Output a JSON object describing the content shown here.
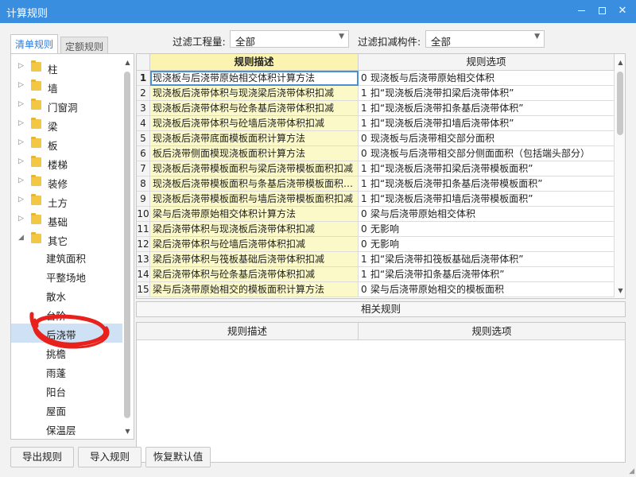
{
  "window": {
    "title": "计算规则"
  },
  "tabs": {
    "list_rules": "清单规则",
    "quota_rules": "定额规则"
  },
  "filters": {
    "quantity_label": "过滤工程量:",
    "quantity_value": "全部",
    "component_label": "过滤扣减构件:",
    "component_value": "全部"
  },
  "tree": {
    "folders": [
      "柱",
      "墙",
      "门窗洞",
      "梁",
      "板",
      "楼梯",
      "装修",
      "土方",
      "基础",
      "其它"
    ],
    "expanded_folder": "其它",
    "children": [
      "建筑面积",
      "平整场地",
      "散水",
      "台阶",
      "后浇带",
      "挑檐",
      "雨蓬",
      "阳台",
      "屋面",
      "保温层"
    ],
    "selected_child": "后浇带"
  },
  "rules_grid": {
    "header_desc": "规则描述",
    "header_opt": "规则选项",
    "rows": [
      {
        "num": "1",
        "desc": "现浇板与后浇带原始相交体积计算方法",
        "flag": "0",
        "option": "现浇板与后浇带原始相交体积"
      },
      {
        "num": "2",
        "desc": "现浇板后浇带体积与现浇梁后浇带体积扣减",
        "flag": "1",
        "option": "扣“现浇板后浇带扣梁后浇带体积”"
      },
      {
        "num": "3",
        "desc": "现浇板后浇带体积与砼条基后浇带体积扣减",
        "flag": "1",
        "option": "扣“现浇板后浇带扣条基后浇带体积”"
      },
      {
        "num": "4",
        "desc": "现浇板后浇带体积与砼墙后浇带体积扣减",
        "flag": "1",
        "option": "扣“现浇板后浇带扣墙后浇带体积”"
      },
      {
        "num": "5",
        "desc": "现浇板后浇带底面模板面积计算方法",
        "flag": "0",
        "option": "现浇板与后浇带相交部分面积"
      },
      {
        "num": "6",
        "desc": "板后浇带侧面模现浇板面积计算方法",
        "flag": "0",
        "option": "现浇板与后浇带相交部分侧面面积（包括端头部分）"
      },
      {
        "num": "7",
        "desc": "现浇板后浇带模板面积与梁后浇带模板面积扣减",
        "flag": "1",
        "option": "扣“现浇板后浇带扣梁后浇带模板面积”"
      },
      {
        "num": "8",
        "desc": "现浇板后浇带模板面积与条基后浇带模板面积扣减",
        "flag": "1",
        "option": "扣“现浇板后浇带扣条基后浇带模板面积”"
      },
      {
        "num": "9",
        "desc": "现浇板后浇带模板面积与墙后浇带模板面积扣减",
        "flag": "1",
        "option": "扣“现浇板后浇带扣墙后浇带模板面积”"
      },
      {
        "num": "10",
        "desc": "梁与后浇带原始相交体积计算方法",
        "flag": "0",
        "option": "梁与后浇带原始相交体积"
      },
      {
        "num": "11",
        "desc": "梁后浇带体积与现浇板后浇带体积扣减",
        "flag": "0",
        "option": "无影响"
      },
      {
        "num": "12",
        "desc": "梁后浇带体积与砼墙后浇带体积扣减",
        "flag": "0",
        "option": "无影响"
      },
      {
        "num": "13",
        "desc": "梁后浇带体积与筏板基础后浇带体积扣减",
        "flag": "1",
        "option": "扣“梁后浇带扣筏板基础后浇带体积”"
      },
      {
        "num": "14",
        "desc": "梁后浇带体积与砼条基后浇带体积扣减",
        "flag": "1",
        "option": "扣“梁后浇带扣条基后浇带体积”"
      },
      {
        "num": "15",
        "desc": "梁与后浇带原始相交的模板面积计算方法",
        "flag": "0",
        "option": "梁与后浇带原始相交的模板面积"
      }
    ]
  },
  "related": {
    "title": "相关规则",
    "header_desc": "规则描述",
    "header_opt": "规则选项"
  },
  "buttons": {
    "export": "导出规则",
    "import": "导入规则",
    "restore": "恢复默认值"
  },
  "colors": {
    "titlebar": "#3a8ee0",
    "highlight_column": "#fbf9c8",
    "annotation": "#e8211c"
  },
  "icons": {
    "folder": "folder-icon",
    "expand": "chevron-right-icon",
    "collapse": "chevron-down-icon"
  }
}
